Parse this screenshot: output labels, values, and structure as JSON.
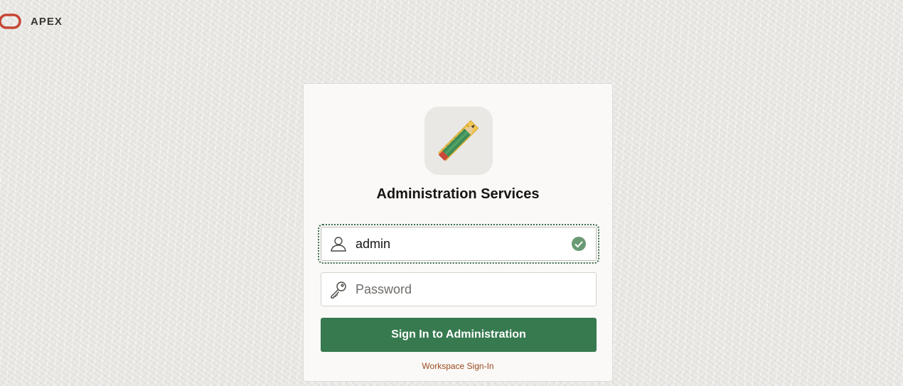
{
  "brand": {
    "name": "APEX",
    "logo_icon": "oracle-logo-icon",
    "logo_color": "#c74634"
  },
  "login": {
    "app_icon": "pencil-ruler-icon",
    "title": "Administration Services",
    "username": {
      "value": "admin",
      "icon": "user-icon",
      "status_icon": "check-circle-icon"
    },
    "password": {
      "placeholder": "Password",
      "icon": "key-icon"
    },
    "submit_label": "Sign In to Administration",
    "workspace_link": "Workspace Sign-In"
  },
  "colors": {
    "primary": "#377a50",
    "link": "#9c4a20",
    "valid": "#6a9a74"
  }
}
